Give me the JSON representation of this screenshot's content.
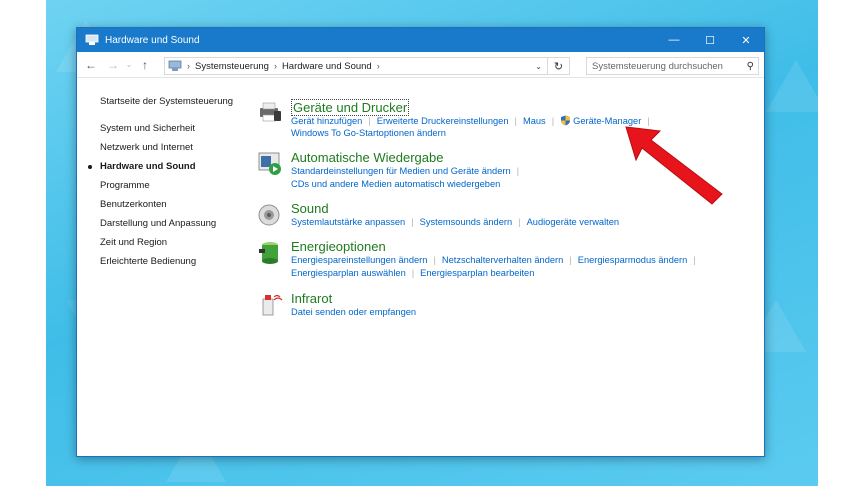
{
  "window": {
    "title": "Hardware und Sound"
  },
  "address": {
    "crumbs": [
      "Systemsteuerung",
      "Hardware und Sound"
    ],
    "search_placeholder": "Systemsteuerung durchsuchen"
  },
  "sidebar": {
    "items": [
      {
        "label": "Startseite der Systemsteuerung"
      },
      {
        "label": "System und Sicherheit"
      },
      {
        "label": "Netzwerk und Internet"
      },
      {
        "label": "Hardware und Sound",
        "active": true
      },
      {
        "label": "Programme"
      },
      {
        "label": "Benutzerkonten"
      },
      {
        "label": "Darstellung und Anpassung"
      },
      {
        "label": "Zeit und Region"
      },
      {
        "label": "Erleichterte Bedienung"
      }
    ]
  },
  "categories": [
    {
      "title": "Geräte und Drucker",
      "icon": "printer-icon",
      "links": [
        [
          "Gerät hinzufügen",
          "Erweiterte Druckereinstellungen",
          "Maus",
          "Geräte-Manager"
        ],
        [
          "Windows To Go-Startoptionen ändern"
        ]
      ]
    },
    {
      "title": "Automatische Wiedergabe",
      "icon": "autoplay-icon",
      "links": [
        [
          "Standardeinstellungen für Medien und Geräte ändern"
        ],
        [
          "CDs und andere Medien automatisch wiedergeben"
        ]
      ]
    },
    {
      "title": "Sound",
      "icon": "speaker-icon",
      "links": [
        [
          "Systemlautstärke anpassen",
          "Systemsounds ändern",
          "Audiogeräte verwalten"
        ]
      ]
    },
    {
      "title": "Energieoptionen",
      "icon": "battery-icon",
      "links": [
        [
          "Energiespareinstellungen ändern",
          "Netzschalterverhalten ändern",
          "Energiesparmodus ändern"
        ],
        [
          "Energiesparplan auswählen",
          "Energiesparplan bearbeiten"
        ]
      ]
    },
    {
      "title": "Infrarot",
      "icon": "infrared-icon",
      "links": [
        [
          "Datei senden oder empfangen"
        ]
      ]
    }
  ],
  "colors": {
    "titlebar": "#1979ca",
    "link": "#0066cc",
    "category_title": "#1e7b1e",
    "annotation_arrow": "#e8141b"
  }
}
